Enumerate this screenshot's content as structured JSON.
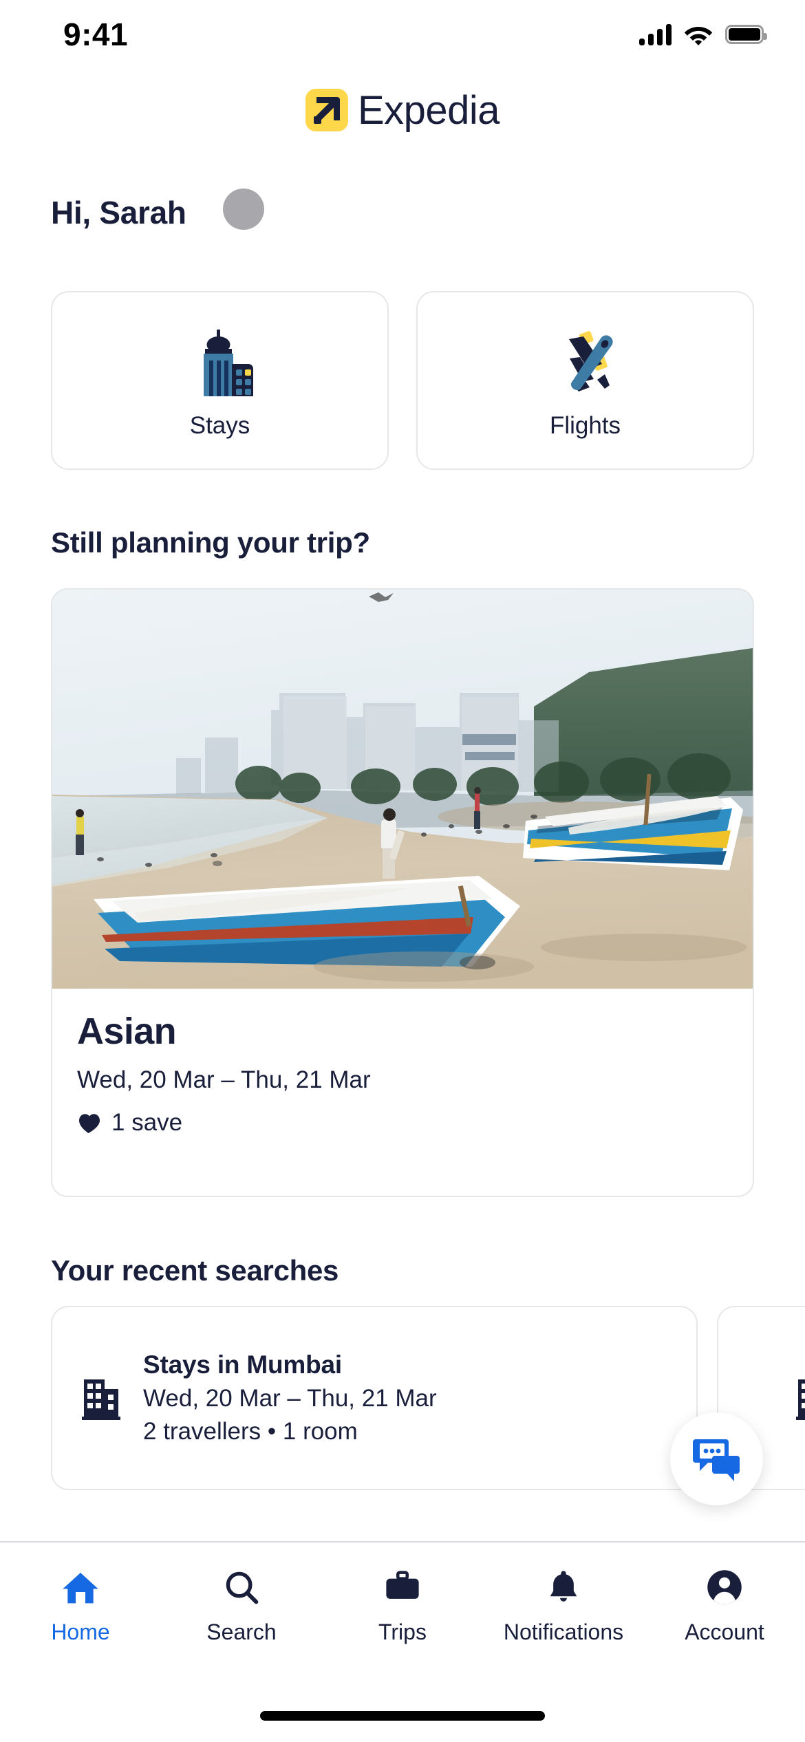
{
  "status_bar": {
    "time": "9:41",
    "cellular_icon": "cellular-signal-icon",
    "wifi_icon": "wifi-icon",
    "battery_icon": "battery-full-icon"
  },
  "app_bar": {
    "logo_mark_icon": "expedia-arrow-logo-icon",
    "brand": "Expedia",
    "brand_yellow": "#FFD74B",
    "brand_navy": "#191E3B"
  },
  "greeting": {
    "text": "Hi, Sarah",
    "avatar_icon": "avatar-placeholder",
    "avatar_color": "#A8A8AC"
  },
  "quick_actions": [
    {
      "label": "Stays",
      "icon": "buildings-icon"
    },
    {
      "label": "Flights",
      "icon": "airplane-icon"
    }
  ],
  "planning": {
    "heading": "Still planning your trip?",
    "card": {
      "photo_icon": "beach-fishing-boats-photo",
      "title": "Asian",
      "dates": "Wed, 20 Mar – Thu, 21 Mar",
      "saves_icon": "heart-filled-icon",
      "saves": "1 save"
    }
  },
  "recent": {
    "heading": "Your recent searches",
    "items": [
      {
        "icon": "building-icon",
        "title": "Stays in Mumbai",
        "dates": "Wed, 20 Mar – Thu, 21 Mar",
        "detail": "2 travellers • 1 room"
      },
      {
        "icon": "building-icon",
        "title": "",
        "dates": "",
        "detail": ""
      }
    ]
  },
  "chat_fab": {
    "icon": "chat-bubbles-icon",
    "color": "#1668E3"
  },
  "bottom_nav": {
    "active_color": "#1668E3",
    "items": [
      {
        "label": "Home",
        "icon": "home-icon",
        "active": true
      },
      {
        "label": "Search",
        "icon": "search-icon",
        "active": false
      },
      {
        "label": "Trips",
        "icon": "briefcase-icon",
        "active": false
      },
      {
        "label": "Notifications",
        "icon": "bell-icon",
        "active": false
      },
      {
        "label": "Account",
        "icon": "account-circle-icon",
        "active": false
      }
    ]
  }
}
